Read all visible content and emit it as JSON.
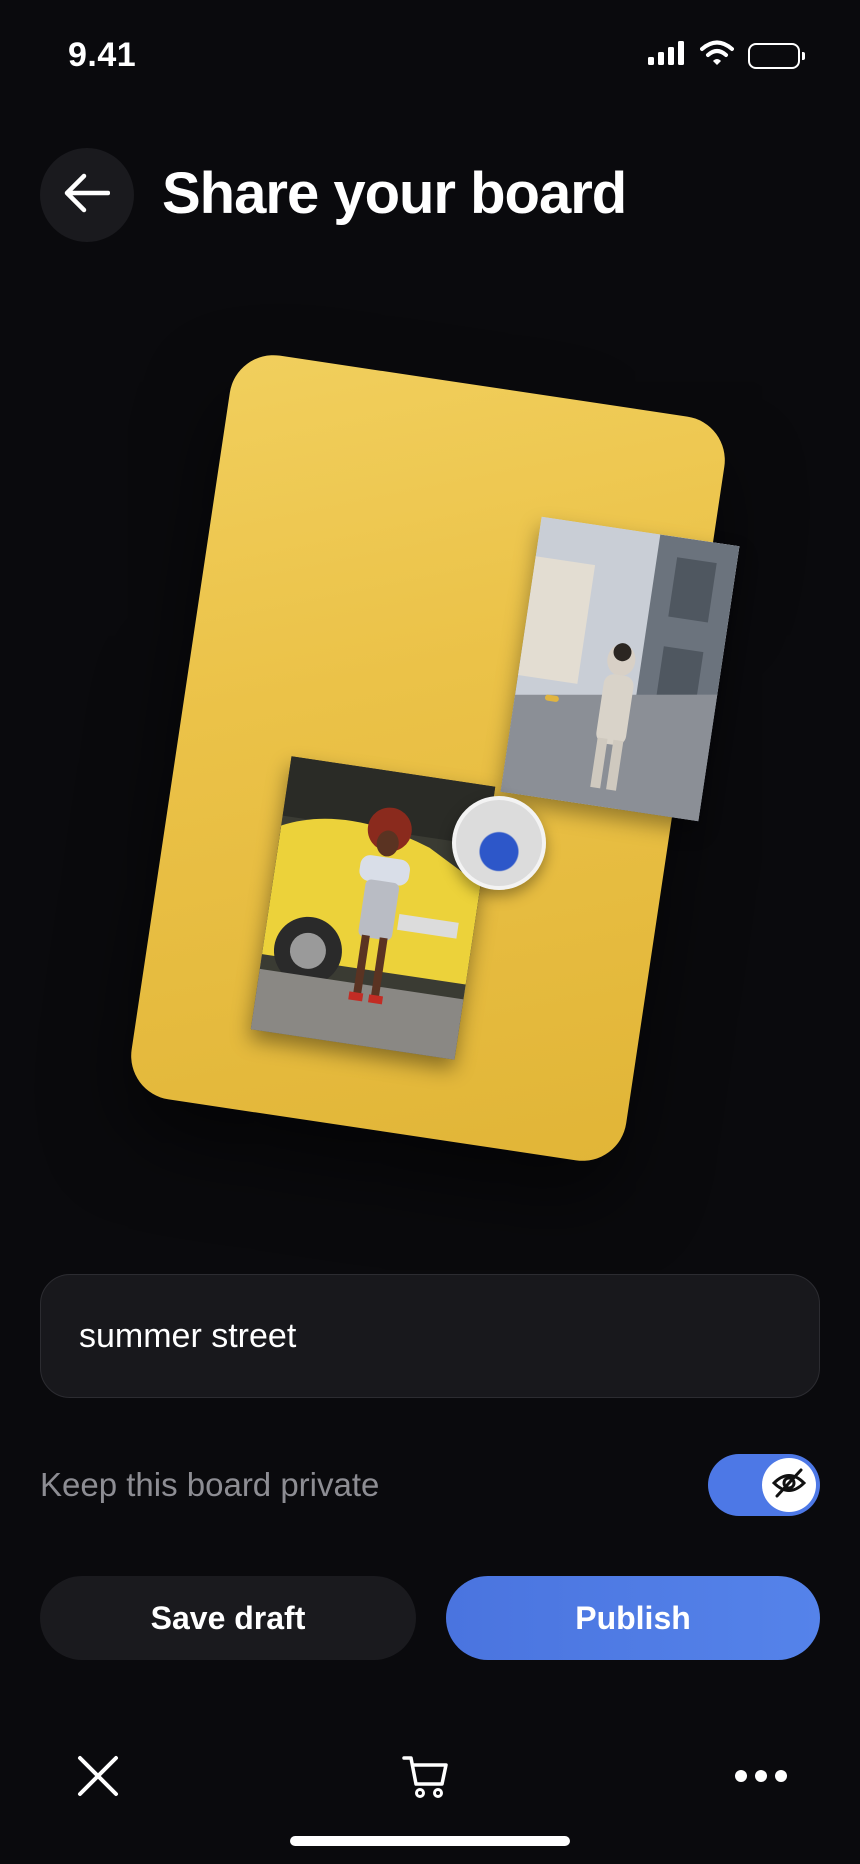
{
  "status_bar": {
    "time": "9.41"
  },
  "header": {
    "title": "Share your board"
  },
  "board": {
    "background_color": "#ebc248"
  },
  "name_field": {
    "value": "summer street"
  },
  "privacy": {
    "label": "Keep this board private",
    "toggle_on": true,
    "toggle_color": "#4d78e6"
  },
  "actions": {
    "save_draft_label": "Save draft",
    "publish_label": "Publish",
    "accent_color": "#5583ea"
  },
  "bottom_bar": {
    "icons": [
      "close-icon",
      "cart-icon",
      "more-icon"
    ]
  }
}
